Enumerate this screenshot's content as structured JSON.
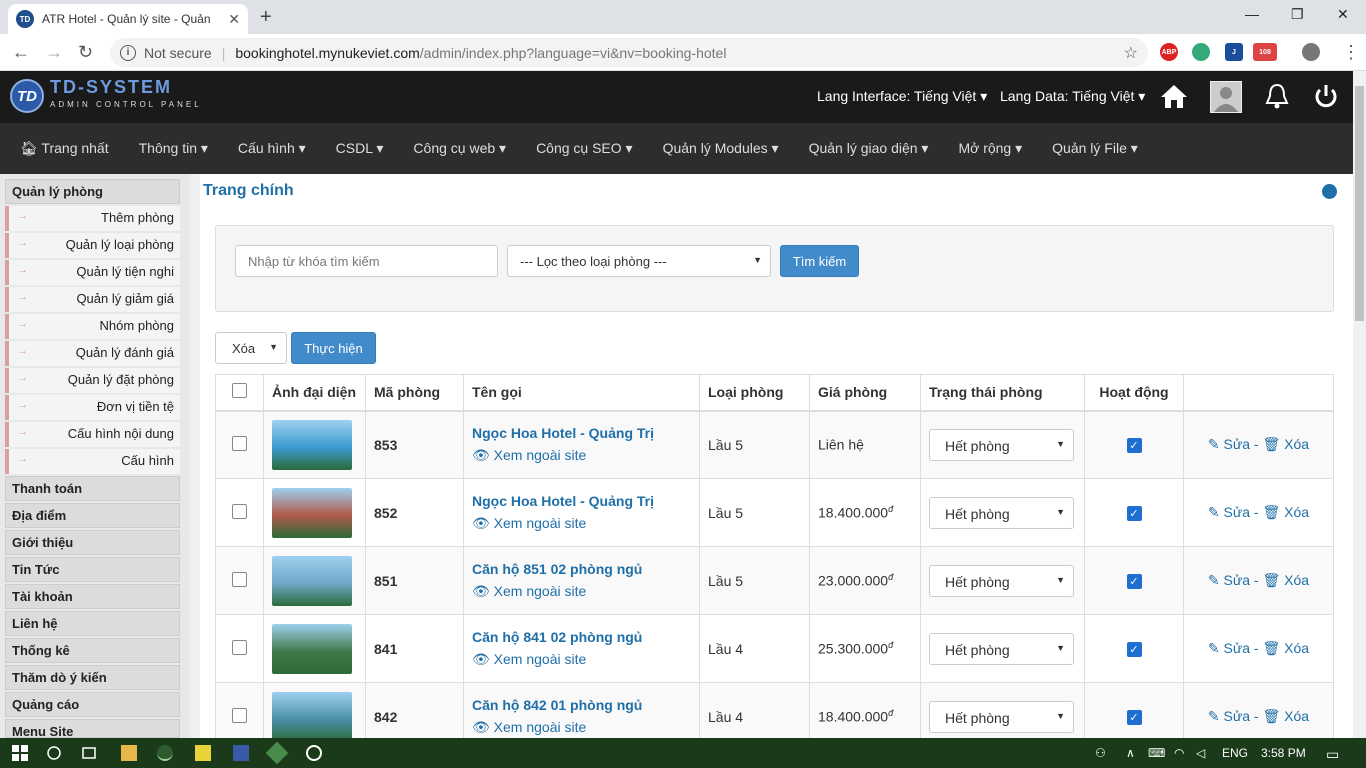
{
  "browser": {
    "tab_title": "ATR Hotel - Quản lý site - Quản lý",
    "favicon_text": "TD",
    "not_secure": "Not secure",
    "url_host": "bookinghotel.mynukeviet.com",
    "url_path": "/admin/index.php?language=vi&nv=booking-hotel",
    "mail_badge": "108"
  },
  "header": {
    "logo_title": "TD-SYSTEM",
    "logo_sub": "ADMIN CONTROL PANEL",
    "lang_interface": "Lang Interface: Tiếng Việt",
    "lang_data": "Lang Data: Tiếng Việt"
  },
  "menu": [
    "Trang nhất",
    "Thông tin",
    "Cấu hình",
    "CSDL",
    "Công cụ web",
    "Công cụ SEO",
    "Quản lý Modules",
    "Quản lý giao diện",
    "Mở rộng",
    "Quản lý File"
  ],
  "sidebar": {
    "group_title": "Quản lý phòng",
    "sub_items": [
      "Thêm phòng",
      "Quản lý loại phòng",
      "Quản lý tiện nghi",
      "Quản lý giảm giá",
      "Nhóm phòng",
      "Quản lý đánh giá",
      "Quản lý đặt phòng",
      "Đơn vị tiền tệ",
      "Cấu hình nội dung",
      "Cấu hình"
    ],
    "groups": [
      "Thanh toán",
      "Địa điểm",
      "Giới thiệu",
      "Tin Tức",
      "Tài khoản",
      "Liên hệ",
      "Thống kê",
      "Thăm dò ý kiến",
      "Quảng cáo",
      "Menu Site"
    ]
  },
  "main": {
    "title": "Trang chính",
    "search_placeholder": "Nhập từ khóa tìm kiếm",
    "filter_select": "--- Lọc theo loại phòng ---",
    "search_button": "Tìm kiếm",
    "bulk_select": "Xóa",
    "bulk_button": "Thực hiện"
  },
  "table": {
    "headers": [
      "Ảnh đại diện",
      "Mã phòng",
      "Tên gọi",
      "Loại phòng",
      "Giá phòng",
      "Trạng thái phòng",
      "Hoạt động"
    ],
    "view_label": "Xem ngoài site",
    "edit_label": "Sửa",
    "delete_label": "Xóa",
    "dash": "-",
    "rows": [
      {
        "code": "853",
        "name": "Ngọc Hoa Hotel - Quảng Trị",
        "type": "Lầu 5",
        "price": "Liên hệ",
        "currency": "",
        "status": "Hết phòng",
        "active": true,
        "img_color": "#3a9bd0"
      },
      {
        "code": "852",
        "name": "Ngọc Hoa Hotel - Quảng Trị",
        "type": "Lầu 5",
        "price": "18.400.000",
        "currency": "đ",
        "status": "Hết phòng",
        "active": true,
        "img_color": "#b05a4a"
      },
      {
        "code": "851",
        "name": "Căn hộ 851 02 phòng ngủ",
        "type": "Lầu 5",
        "price": "23.000.000",
        "currency": "đ",
        "status": "Hết phòng",
        "active": true,
        "img_color": "#6fa8c8"
      },
      {
        "code": "841",
        "name": "Căn hộ 841 02 phòng ngủ",
        "type": "Lầu 4",
        "price": "25.300.000",
        "currency": "đ",
        "status": "Hết phòng",
        "active": true,
        "img_color": "#3f7a4a"
      },
      {
        "code": "842",
        "name": "Căn hộ 842 01 phòng ngủ",
        "type": "Lầu 4",
        "price": "18.400.000",
        "currency": "đ",
        "status": "Hết phòng",
        "active": true,
        "img_color": "#4a8fa8"
      }
    ]
  },
  "taskbar": {
    "lang": "ENG",
    "time": "3:58 PM"
  }
}
